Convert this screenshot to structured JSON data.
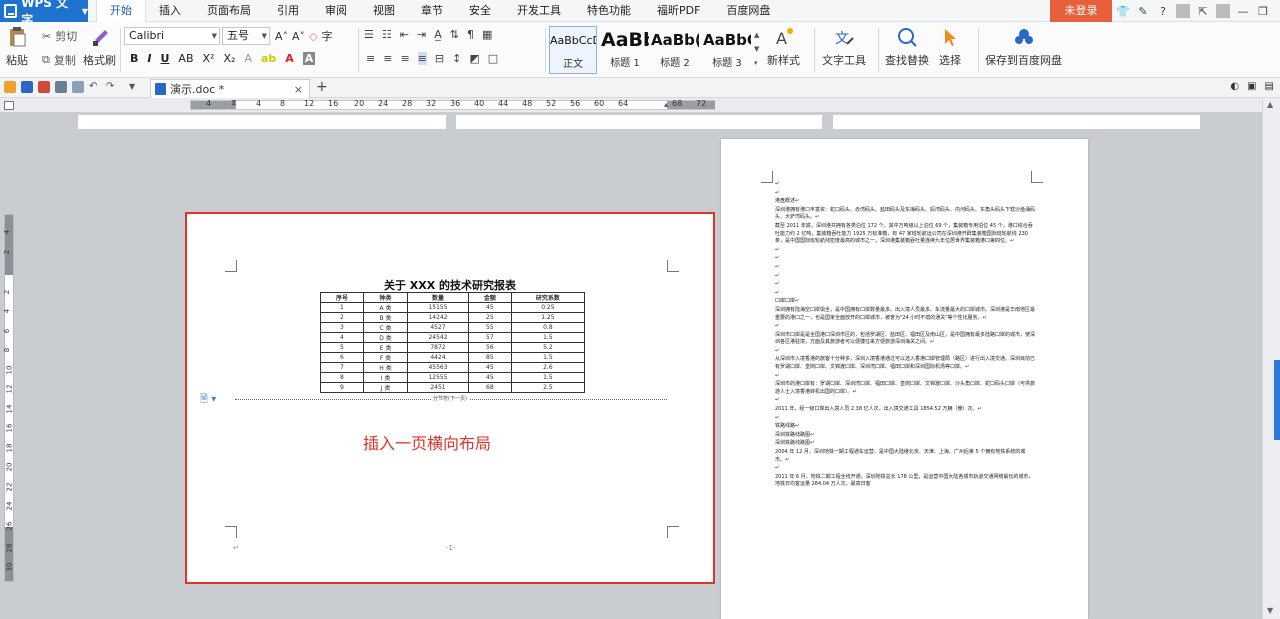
{
  "app": {
    "name": "WPS 文字",
    "menu_tabs": [
      "开始",
      "插入",
      "页面布局",
      "引用",
      "审阅",
      "视图",
      "章节",
      "安全",
      "开发工具",
      "特色功能",
      "福昕PDF",
      "百度网盘"
    ],
    "login_label": "未登录",
    "win_help": "?",
    "win_min": "—",
    "win_restore": "❐",
    "win_close": "✕"
  },
  "ribbon": {
    "paste_label": "粘贴",
    "cut_label": "剪切",
    "copy_label": "复制",
    "format_painter_label": "格式刷",
    "font_name": "Calibri",
    "font_size": "五号",
    "styles": [
      {
        "sample": "AaBbCcDd",
        "label": "正文"
      },
      {
        "sample": "AaBb",
        "label": "标题 1"
      },
      {
        "sample": "AaBb(",
        "label": "标题 2"
      },
      {
        "sample": "AaBbC",
        "label": "标题 3"
      }
    ],
    "new_style_label": "新样式",
    "text_tools_label": "文字工具",
    "find_replace_label": "查找替换",
    "select_label": "选择",
    "save_baidu_label": "保存到百度网盘"
  },
  "tabs": {
    "doc_tab_label": "演示.doc *",
    "close_glyph": "×",
    "add_glyph": "+"
  },
  "ruler": {
    "numbers": [
      "4",
      "4",
      "8",
      "12",
      "16",
      "20",
      "24",
      "28",
      "32",
      "36",
      "40",
      "44",
      "48",
      "52",
      "56",
      "60",
      "64",
      "68",
      "72"
    ]
  },
  "vruler": {
    "numbers": [
      "4",
      "2",
      "2",
      "4",
      "6",
      "8",
      "10",
      "12",
      "14",
      "16",
      "18",
      "20",
      "22",
      "24",
      "26",
      "28",
      "30"
    ]
  },
  "page1": {
    "title": "关于 XXX 的技术研究报表",
    "table_headers": [
      "序号",
      "种类",
      "数量",
      "金额",
      "研究系数"
    ],
    "table_rows": [
      [
        "1",
        "A 类",
        "15155",
        "45",
        "0.25"
      ],
      [
        "2",
        "B 类",
        "14242",
        "25",
        "1.25"
      ],
      [
        "3",
        "C 类",
        "4527",
        "55",
        "0.8"
      ],
      [
        "4",
        "D 类",
        "24542",
        "57",
        "1.5"
      ],
      [
        "5",
        "E 类",
        "7872",
        "56",
        "5.2"
      ],
      [
        "6",
        "F 类",
        "4424",
        "85",
        "1.5"
      ],
      [
        "7",
        "H 类",
        "45563",
        "45",
        "2.6"
      ],
      [
        "8",
        "I 类",
        "12555",
        "45",
        "1.5"
      ],
      [
        "9",
        "J 类",
        "2451",
        "68",
        "2.5"
      ]
    ],
    "section_break": "分节符(下一页)",
    "annotation": "插入一页横向布局",
    "footer_mark": "-1-"
  },
  "page2": {
    "paragraphs": [
      "↵",
      "↵",
      "港盘概述↵",
      "深圳港拥有港口丰富资：蛇口码头、赤湾码头、盐田码头及东海码头、妈湾码头、内河码头、东角头码头下辖沙渔涌码头、大铲湾码头。↵",
      "截至 2011 年底，深圳港共拥有各类泊位 172 个，其中万吨级以上泊位 69 个，集装箱专用泊位 45 个，港口综合吞吐能力约 2 亿吨，集装箱吞吐能力 1925 万标准箱，有 47 家班轮航运公司在深圳港开辟集装箱国际班轮航线 230 条，是中国国际班轮航线密度最高的城市之一，深圳港集装箱吞吐量连续九年位居世界集装箱港口第四位。↵",
      "↵",
      "↵",
      "↵",
      "↵",
      "↵",
      "↵",
      "口岸口岸↵",
      "深圳拥有陆海空口岸俱全，是中国拥有口岸数量最多、出入境人员最多、车流量最大的口岸城市。深圳港是华南地区最重要的港口之一，也是国家全面放开的口岸城市，被誉为\"24 小时不熄的通关\"等个性化服务。↵",
      "↵",
      "深圳市口岸是是全国港口深圳市区的，包括罗湖区、盐田区、福田区及南山区，是中国拥有最多陆路口岸的城市，使深圳各区港驻境，方面及其旅游者可以便捷往来方便旅游深圳海关之间。↵",
      "↵",
      "从深圳市入境香港的旅客十分种多，深圳入境香港通过可以选入香港口岸管理局（路区）进行出入境交通。深圳目前已有罗湖口岸、皇岗口岸、文锦渡口岸、深圳湾口岸、福田口岸和深圳国际机场等口岸。↵",
      "↵",
      "深圳市的港口岸有：罗湖口岸、深圳湾口岸、福田口岸、皇岗口岸、文锦渡口岸、沙头角口岸、蛇口码头口岸（可供旅游人士入境香港转机出国的口岸）。↵",
      "↵",
      "2011 年，经一级口岸出入境人员 2.38 亿人次，出入境交通工具 1854.52 万辆（艘）次。↵",
      "↵",
      "铁路线路↵",
      "深圳铁路线路图↵",
      "深圳铁路线路图↵",
      "2004 年 12 月，深圳地铁一期工程通车运营，是中国大陆继北京、天津、上海、广州后第 5 个拥有地铁系统的城市。↵",
      "↵",
      "2011 年 6 月，地铁二期工程全线开通，深圳地铁总长 178 公里，是运营中国大陆各城市轨道交通网络最长的城市，地铁日均客运量 284.04 万人次，最高日客"
    ]
  },
  "colors": {
    "accent": "#1f73d0",
    "login": "#e8603a",
    "highlight_border": "#e0332a",
    "annotation": "#e0332a"
  }
}
